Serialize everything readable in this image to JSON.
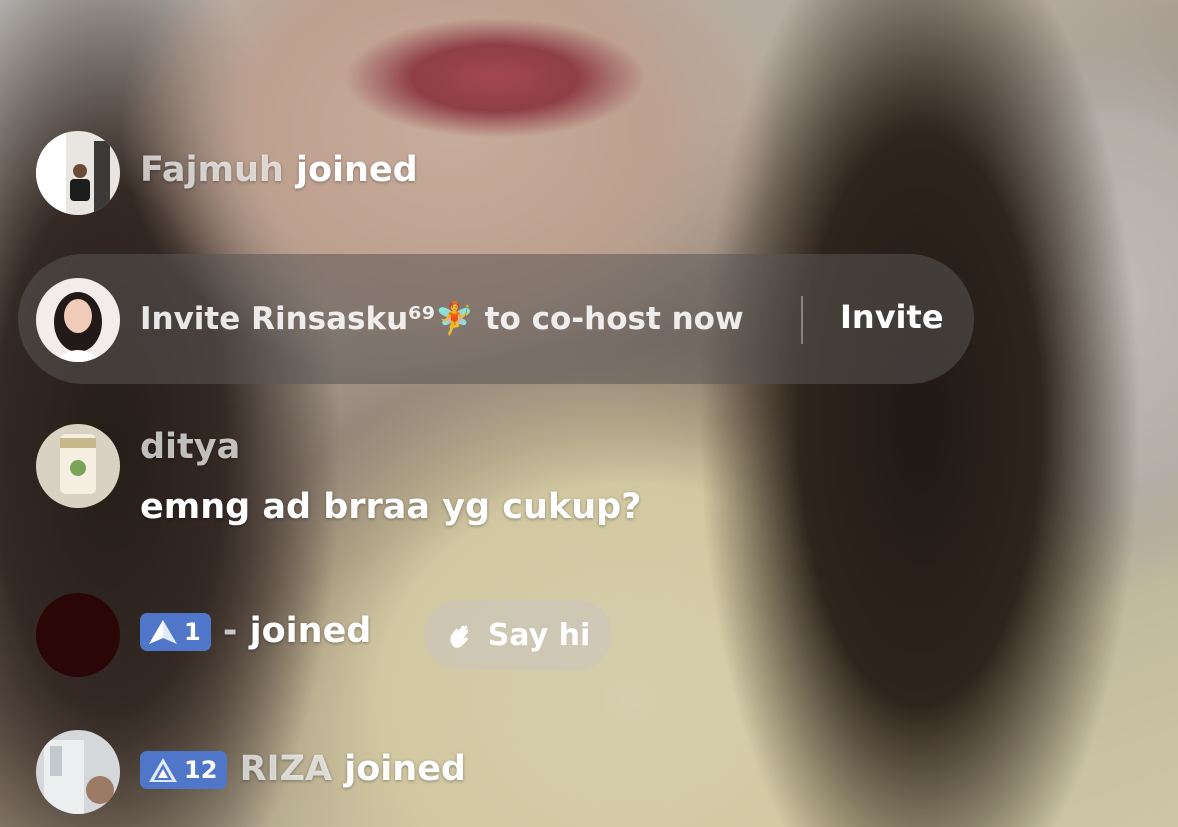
{
  "chat": {
    "messages": [
      {
        "username": "Fajmuh",
        "action": "joined"
      },
      {
        "username": "ditya",
        "text": "emng ad brraa yg cukup?"
      },
      {
        "level": "1",
        "username": "-",
        "action": "joined",
        "say_hi_label": "Say hi"
      },
      {
        "level": "12",
        "username": "RIZA",
        "action": "joined"
      }
    ]
  },
  "invite_prompt": {
    "prefix": "Invite ",
    "username": "Rinsasku⁶⁹",
    "emoji": "🧚",
    "suffix": " to co-host now",
    "button_label": "Invite"
  },
  "colors": {
    "badge": "#4f76c9",
    "text": "#ffffff",
    "pill": "#5a5654"
  }
}
